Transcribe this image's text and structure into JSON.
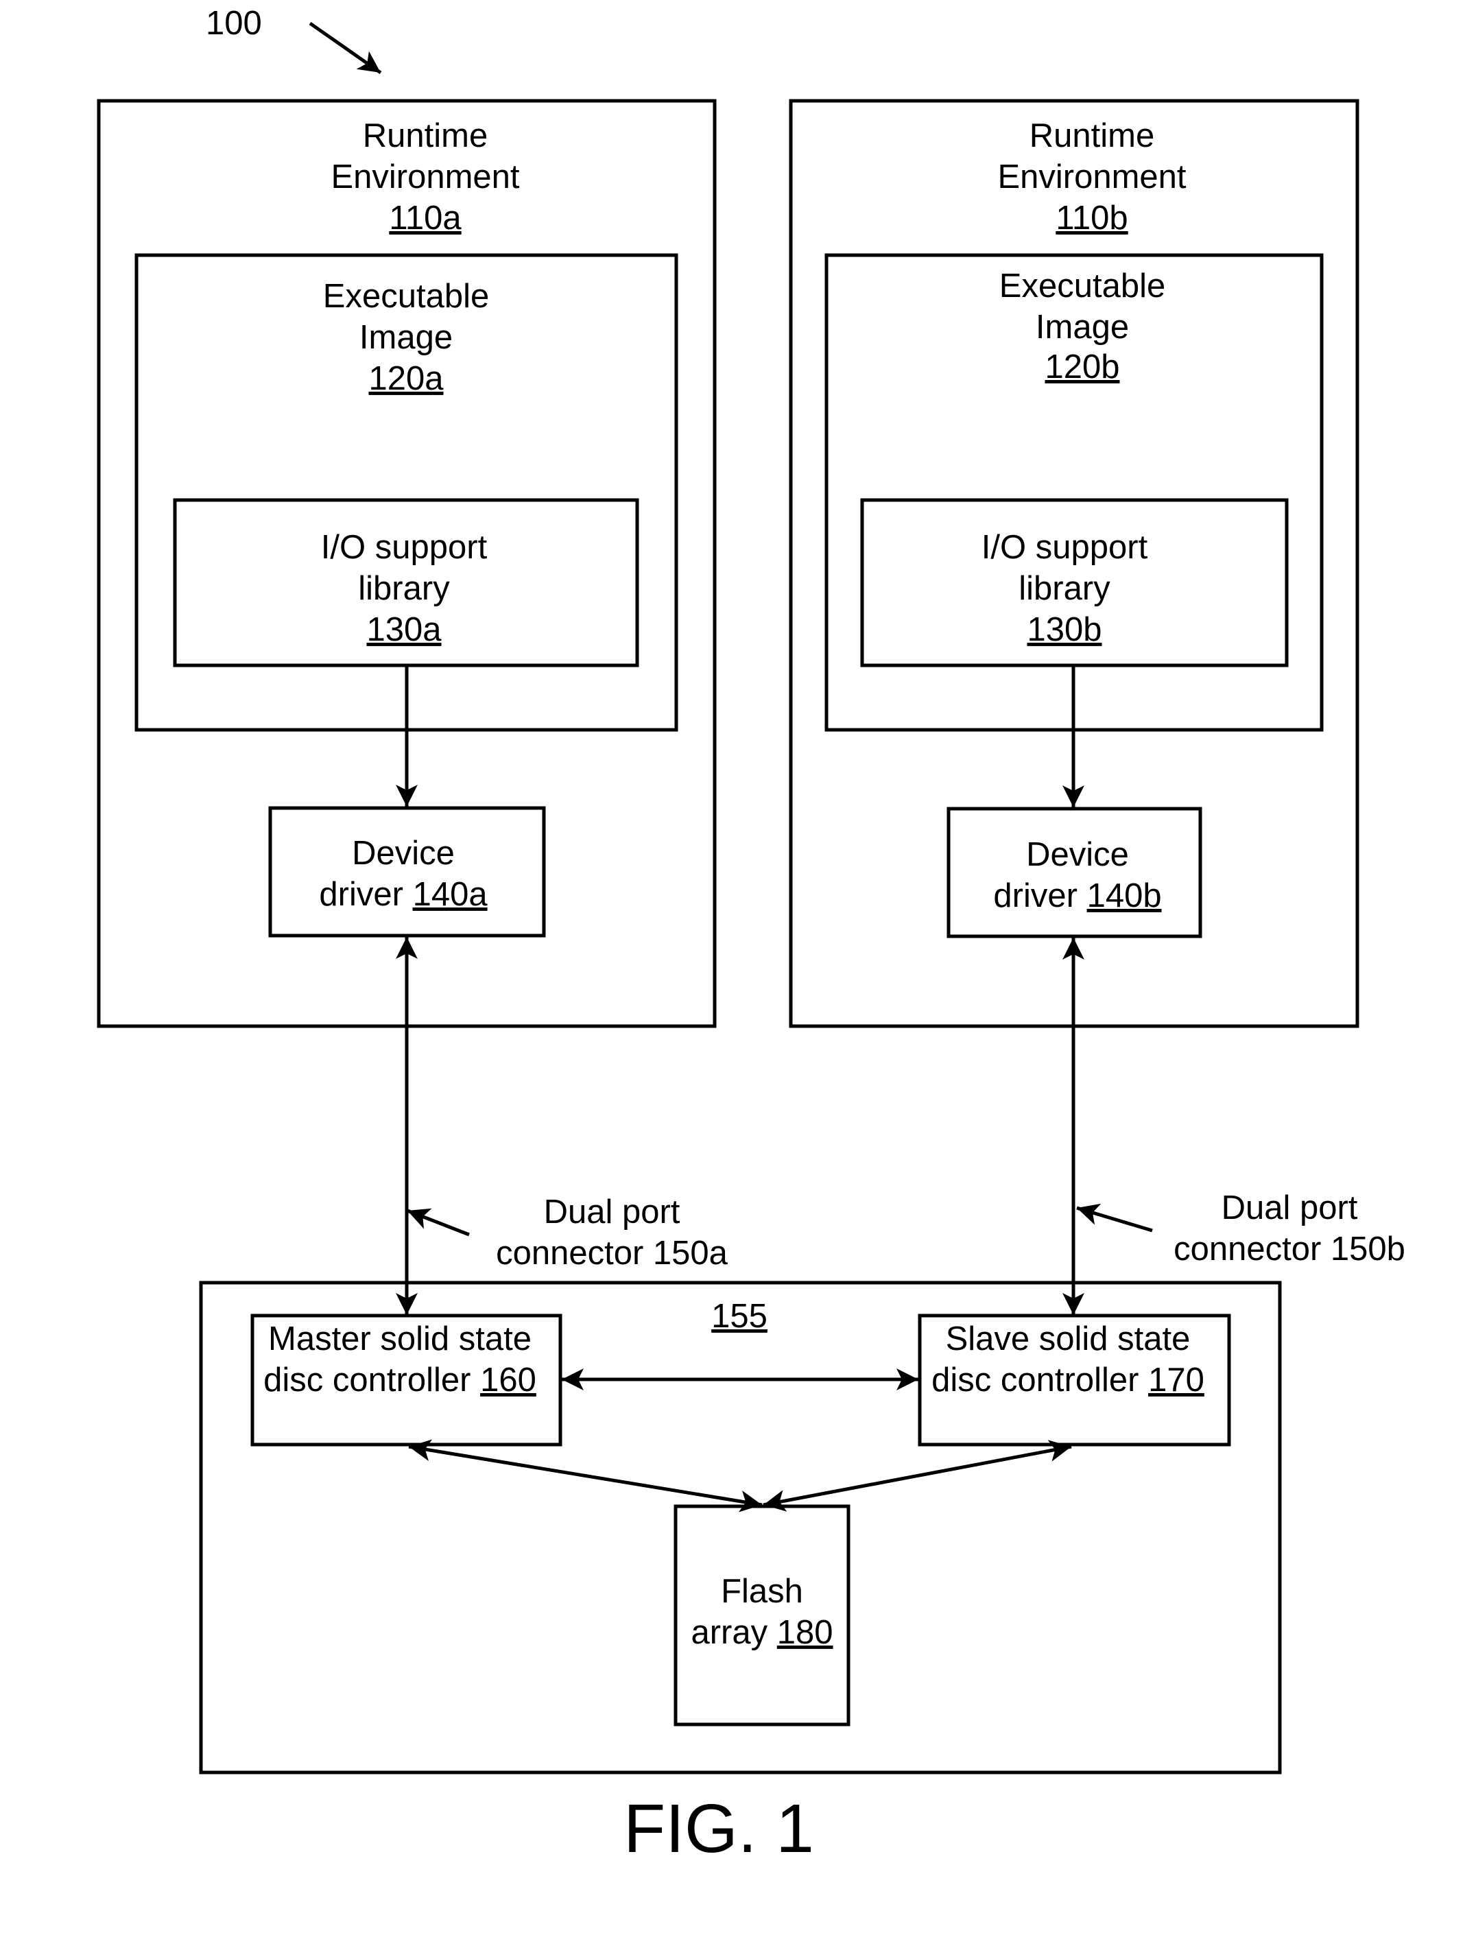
{
  "figure": {
    "reference_numeral": "100",
    "caption": "FIG. 1"
  },
  "runtime_a": {
    "title_lines": [
      "Runtime",
      "Environment"
    ],
    "ref": "110a",
    "executable": {
      "title_lines": [
        "Executable",
        "Image"
      ],
      "ref": "120a"
    },
    "io_library": {
      "title_lines": [
        "I/O support",
        "library"
      ],
      "ref": "130a"
    },
    "device_driver": {
      "line1": "Device",
      "line2_prefix": "driver ",
      "ref": "140a"
    }
  },
  "runtime_b": {
    "title_lines": [
      "Runtime",
      "Environment"
    ],
    "ref": "110b",
    "executable": {
      "title_lines": [
        "Executable",
        "Image"
      ],
      "ref": "120b"
    },
    "io_library": {
      "title_lines": [
        "I/O support",
        "library"
      ],
      "ref": "130b"
    },
    "device_driver": {
      "line1": "Device",
      "line2_prefix": "driver ",
      "ref": "140b"
    }
  },
  "connector_a": {
    "line1": "Dual port",
    "line2": "connector 150a"
  },
  "connector_b": {
    "line1": "Dual port",
    "line2": "connector 150b"
  },
  "storage": {
    "ref": "155",
    "master": {
      "line1": "Master solid state",
      "line2_prefix": "disc controller ",
      "ref": "160"
    },
    "slave": {
      "line1": "Slave solid state",
      "line2_prefix": "disc controller ",
      "ref": "170"
    },
    "flash": {
      "line1": "Flash",
      "line2_prefix": "array ",
      "ref": "180"
    }
  },
  "colors": {
    "ink": "#000000",
    "background": "#ffffff"
  }
}
